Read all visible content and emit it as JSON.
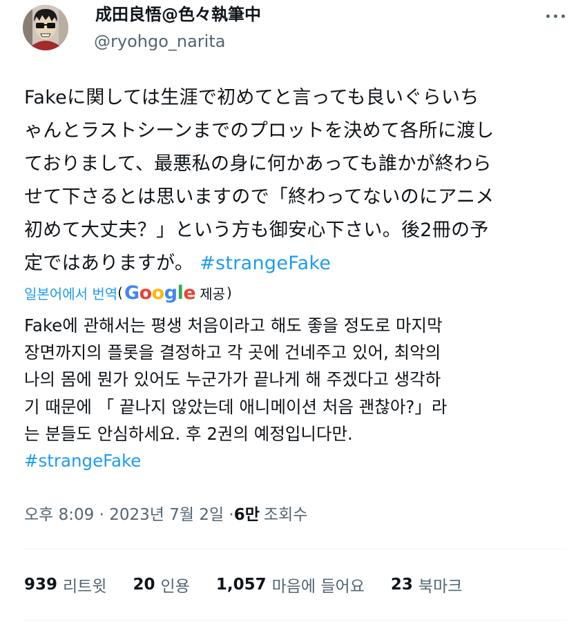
{
  "author": {
    "display_name": "成田良悟@色々執筆中",
    "handle": "@ryohgo_narita",
    "avatar_icon": "avatar-icon"
  },
  "tweet": {
    "lines": [
      "Fakeに関しては生涯で初めてと言っても良いぐらいち",
      "ゃんとラストシーンまでのプロットを決めて各所に渡し",
      "ておりまして、最悪私の身に何かあっても誰かが終わら",
      "せて下さるとは思いますので「終わってないのにアニメ",
      "初めて大丈夫？」という方も御安心下さい。後2冊の予",
      "定ではありますが。"
    ],
    "hashtag": "#strangeFake"
  },
  "translation": {
    "link_label": "일본어에서 번역",
    "open_paren": "(",
    "google_letters": [
      "G",
      "o",
      "o",
      "g",
      "l",
      "e"
    ],
    "provided_label": "제공",
    "close_paren": ")",
    "lines": [
      "Fake에 관해서는 평생 처음이라고 해도 좋을 정도로 마지막",
      "장면까지의 플롯을 결정하고 각 곳에 건네주고 있어, 최악의",
      "나의 몸에 뭔가 있어도 누군가가 끝나게 해 주겠다고 생각하",
      "기 때문에 「 끝나지 않았는데 애니메이션 처음 괜찮아?」라",
      "는 분들도 안심하세요. 후 2권의 예정입니다만."
    ],
    "hashtag": "#strangeFake"
  },
  "meta": {
    "timestamp": "오후 8:09 · 2023년 7월 2일 · ",
    "views_count": "6만",
    "views_label": "조회수"
  },
  "stats": [
    {
      "count": "939",
      "label": "리트윗"
    },
    {
      "count": "20",
      "label": "인용"
    },
    {
      "count": "1,057",
      "label": "마음에 들어요"
    },
    {
      "count": "23",
      "label": "북마크"
    }
  ],
  "colors": {
    "link": "#1d9bf0",
    "secondary_text": "#536471",
    "primary_text": "#0f1419"
  }
}
